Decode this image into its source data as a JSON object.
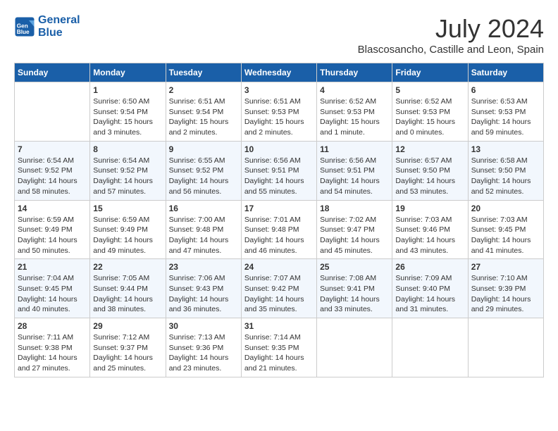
{
  "header": {
    "logo_line1": "General",
    "logo_line2": "Blue",
    "month_year": "July 2024",
    "location": "Blascosancho, Castille and Leon, Spain"
  },
  "days_of_week": [
    "Sunday",
    "Monday",
    "Tuesday",
    "Wednesday",
    "Thursday",
    "Friday",
    "Saturday"
  ],
  "weeks": [
    [
      {
        "day": "",
        "info": ""
      },
      {
        "day": "1",
        "info": "Sunrise: 6:50 AM\nSunset: 9:54 PM\nDaylight: 15 hours\nand 3 minutes."
      },
      {
        "day": "2",
        "info": "Sunrise: 6:51 AM\nSunset: 9:54 PM\nDaylight: 15 hours\nand 2 minutes."
      },
      {
        "day": "3",
        "info": "Sunrise: 6:51 AM\nSunset: 9:53 PM\nDaylight: 15 hours\nand 2 minutes."
      },
      {
        "day": "4",
        "info": "Sunrise: 6:52 AM\nSunset: 9:53 PM\nDaylight: 15 hours\nand 1 minute."
      },
      {
        "day": "5",
        "info": "Sunrise: 6:52 AM\nSunset: 9:53 PM\nDaylight: 15 hours\nand 0 minutes."
      },
      {
        "day": "6",
        "info": "Sunrise: 6:53 AM\nSunset: 9:53 PM\nDaylight: 14 hours\nand 59 minutes."
      }
    ],
    [
      {
        "day": "7",
        "info": "Sunrise: 6:54 AM\nSunset: 9:52 PM\nDaylight: 14 hours\nand 58 minutes."
      },
      {
        "day": "8",
        "info": "Sunrise: 6:54 AM\nSunset: 9:52 PM\nDaylight: 14 hours\nand 57 minutes."
      },
      {
        "day": "9",
        "info": "Sunrise: 6:55 AM\nSunset: 9:52 PM\nDaylight: 14 hours\nand 56 minutes."
      },
      {
        "day": "10",
        "info": "Sunrise: 6:56 AM\nSunset: 9:51 PM\nDaylight: 14 hours\nand 55 minutes."
      },
      {
        "day": "11",
        "info": "Sunrise: 6:56 AM\nSunset: 9:51 PM\nDaylight: 14 hours\nand 54 minutes."
      },
      {
        "day": "12",
        "info": "Sunrise: 6:57 AM\nSunset: 9:50 PM\nDaylight: 14 hours\nand 53 minutes."
      },
      {
        "day": "13",
        "info": "Sunrise: 6:58 AM\nSunset: 9:50 PM\nDaylight: 14 hours\nand 52 minutes."
      }
    ],
    [
      {
        "day": "14",
        "info": "Sunrise: 6:59 AM\nSunset: 9:49 PM\nDaylight: 14 hours\nand 50 minutes."
      },
      {
        "day": "15",
        "info": "Sunrise: 6:59 AM\nSunset: 9:49 PM\nDaylight: 14 hours\nand 49 minutes."
      },
      {
        "day": "16",
        "info": "Sunrise: 7:00 AM\nSunset: 9:48 PM\nDaylight: 14 hours\nand 47 minutes."
      },
      {
        "day": "17",
        "info": "Sunrise: 7:01 AM\nSunset: 9:48 PM\nDaylight: 14 hours\nand 46 minutes."
      },
      {
        "day": "18",
        "info": "Sunrise: 7:02 AM\nSunset: 9:47 PM\nDaylight: 14 hours\nand 45 minutes."
      },
      {
        "day": "19",
        "info": "Sunrise: 7:03 AM\nSunset: 9:46 PM\nDaylight: 14 hours\nand 43 minutes."
      },
      {
        "day": "20",
        "info": "Sunrise: 7:03 AM\nSunset: 9:45 PM\nDaylight: 14 hours\nand 41 minutes."
      }
    ],
    [
      {
        "day": "21",
        "info": "Sunrise: 7:04 AM\nSunset: 9:45 PM\nDaylight: 14 hours\nand 40 minutes."
      },
      {
        "day": "22",
        "info": "Sunrise: 7:05 AM\nSunset: 9:44 PM\nDaylight: 14 hours\nand 38 minutes."
      },
      {
        "day": "23",
        "info": "Sunrise: 7:06 AM\nSunset: 9:43 PM\nDaylight: 14 hours\nand 36 minutes."
      },
      {
        "day": "24",
        "info": "Sunrise: 7:07 AM\nSunset: 9:42 PM\nDaylight: 14 hours\nand 35 minutes."
      },
      {
        "day": "25",
        "info": "Sunrise: 7:08 AM\nSunset: 9:41 PM\nDaylight: 14 hours\nand 33 minutes."
      },
      {
        "day": "26",
        "info": "Sunrise: 7:09 AM\nSunset: 9:40 PM\nDaylight: 14 hours\nand 31 minutes."
      },
      {
        "day": "27",
        "info": "Sunrise: 7:10 AM\nSunset: 9:39 PM\nDaylight: 14 hours\nand 29 minutes."
      }
    ],
    [
      {
        "day": "28",
        "info": "Sunrise: 7:11 AM\nSunset: 9:38 PM\nDaylight: 14 hours\nand 27 minutes."
      },
      {
        "day": "29",
        "info": "Sunrise: 7:12 AM\nSunset: 9:37 PM\nDaylight: 14 hours\nand 25 minutes."
      },
      {
        "day": "30",
        "info": "Sunrise: 7:13 AM\nSunset: 9:36 PM\nDaylight: 14 hours\nand 23 minutes."
      },
      {
        "day": "31",
        "info": "Sunrise: 7:14 AM\nSunset: 9:35 PM\nDaylight: 14 hours\nand 21 minutes."
      },
      {
        "day": "",
        "info": ""
      },
      {
        "day": "",
        "info": ""
      },
      {
        "day": "",
        "info": ""
      }
    ]
  ]
}
